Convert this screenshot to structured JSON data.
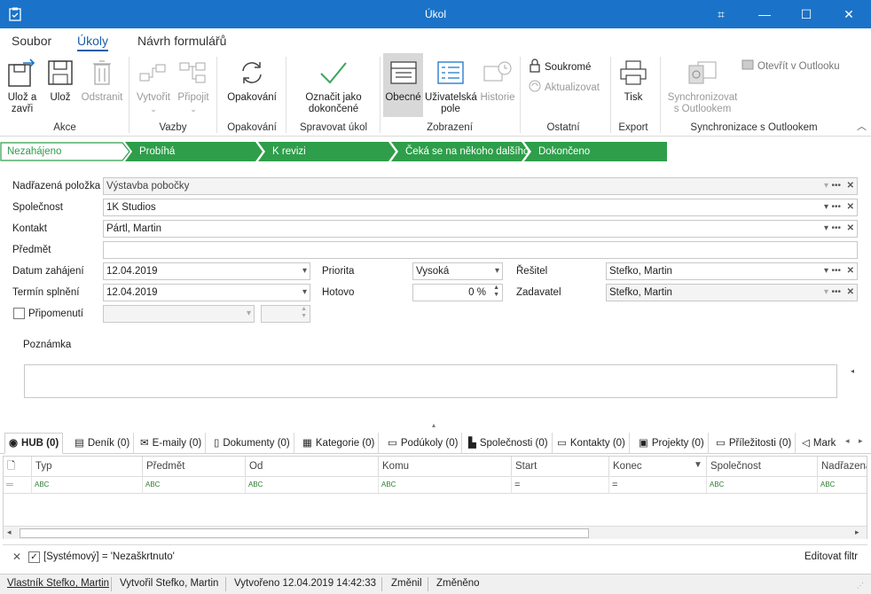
{
  "window": {
    "title": "Úkol",
    "buttons": [
      "restore",
      "minimize",
      "maximize",
      "close"
    ]
  },
  "menu": {
    "tabs": [
      "Soubor",
      "Úkoly",
      "Návrh formulářů"
    ],
    "active": "Úkoly"
  },
  "ribbon": {
    "akce": {
      "group": "Akce",
      "save_close": "Ulož a\nzavři",
      "save": "Ulož",
      "delete": "Odstranit"
    },
    "vazby": {
      "group": "Vazby",
      "create": "Vytvořit",
      "attach": "Připojit"
    },
    "opakovani": {
      "group": "Opakování",
      "repeat": "Opakování"
    },
    "spravovat": {
      "group": "Spravovat úkol",
      "mark_done": "Označit jako\ndokončené"
    },
    "zobrazeni": {
      "group": "Zobrazení",
      "general": "Obecné",
      "user_fields": "Uživatelská\npole",
      "history": "Historie"
    },
    "ostatni": {
      "group": "Ostatní",
      "private": "Soukromé",
      "refresh": "Aktualizovat"
    },
    "export": {
      "group": "Export",
      "print": "Tisk"
    },
    "sync": {
      "group": "Synchronizace s Outlookem",
      "sync_btn": "Synchronizovat\ns Outlookem",
      "open_outlook": "Otevřít v Outlooku"
    }
  },
  "stages": [
    "Nezahájeno",
    "Probíhá",
    "K revizi",
    "Čeká se na někoho dalšího",
    "Dokončeno"
  ],
  "form": {
    "parent_label": "Nadřazená položka",
    "parent_value": "Výstavba pobočky",
    "company_label": "Společnost",
    "company_value": "1K Studios",
    "contact_label": "Kontakt",
    "contact_value": "Pártl, Martin",
    "subject_label": "Předmět",
    "subject_value": "",
    "start_label": "Datum zahájení",
    "start_value": "12.04.2019",
    "due_label": "Termín splnění",
    "due_value": "12.04.2019",
    "reminder_label": "Připomenutí",
    "priority_label": "Priorita",
    "priority_value": "Vysoká",
    "done_label": "Hotovo",
    "done_value": "0 %",
    "solver_label": "Řešitel",
    "solver_value": "Stefko, Martin",
    "assigner_label": "Zadavatel",
    "assigner_value": "Stefko, Martin",
    "note_label": "Poznámka"
  },
  "bottom_tabs": [
    {
      "label": "HUB (0)",
      "icon": "hub-icon"
    },
    {
      "label": "Deník (0)",
      "icon": "journal-icon"
    },
    {
      "label": "E-maily (0)",
      "icon": "mail-icon"
    },
    {
      "label": "Dokumenty (0)",
      "icon": "document-icon"
    },
    {
      "label": "Kategorie (0)",
      "icon": "category-icon"
    },
    {
      "label": "Podúkoly (0)",
      "icon": "subtask-icon"
    },
    {
      "label": "Společnosti (0)",
      "icon": "building-icon"
    },
    {
      "label": "Kontakty (0)",
      "icon": "contact-card-icon"
    },
    {
      "label": "Projekty (0)",
      "icon": "project-icon"
    },
    {
      "label": "Příležitosti (0)",
      "icon": "opportunity-icon"
    },
    {
      "label": "Mark",
      "icon": "megaphone-icon"
    }
  ],
  "grid": {
    "columns": [
      "Typ",
      "Předmět",
      "Od",
      "Komu",
      "Start",
      "Konec",
      "Společnost",
      "Nadřazená"
    ],
    "filter_tokens": [
      "ABC",
      "ABC",
      "ABC",
      "ABC",
      "=",
      "=",
      "ABC",
      "ABC"
    ]
  },
  "filter": {
    "text": "[Systémový] = 'Nezaškrtnuto'",
    "edit": "Editovat filtr"
  },
  "status": {
    "owner": "Vlastník Stefko, Martin",
    "created_by": "Vytvořil Stefko, Martin",
    "created": "Vytvořeno 12.04.2019 14:42:33",
    "changed_by": "Změnil",
    "changed": "Změněno"
  },
  "colors": {
    "accent": "#1a73c8",
    "stage_green": "#2e9e4a"
  }
}
